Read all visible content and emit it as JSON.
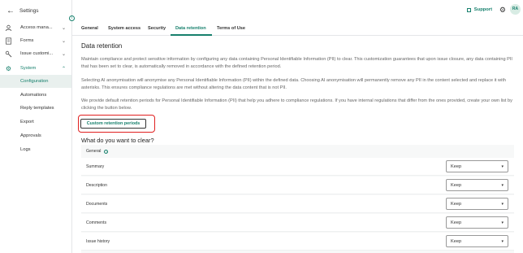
{
  "sidebar": {
    "header": {
      "back_icon": "arrow-left-icon",
      "title": "Settings"
    },
    "items": [
      {
        "label": "Access mana...",
        "icon": "user-icon"
      },
      {
        "label": "Forms",
        "icon": "form-icon"
      },
      {
        "label": "Issue customi...",
        "icon": "wrench-icon"
      },
      {
        "label": "System",
        "icon": "gear-icon"
      }
    ],
    "sub_items": [
      "Configuration",
      "Automations",
      "Reply templates",
      "Export",
      "Approvals",
      "Logs"
    ],
    "active_sub": "Configuration"
  },
  "topbar": {
    "support": "Support",
    "avatar_initials": "RA"
  },
  "tabs": [
    "General",
    "System access",
    "Security",
    "Data retention",
    "Terms of Use"
  ],
  "active_tab": "Data retention",
  "content": {
    "title": "Data retention",
    "para1": "Maintain compliance and protect sensitive information by configuring any data containing Personal Identifiable Information (PII) to clear. This customization guarantees that upon issue closure, any data containing PII that has been set to clear, is automatically removed in accordance with the defined retention period.",
    "para2": "Selecting AI anonymisation will anonymise any Personal Identifiable Information (PII) within the defined data. Choosing AI anonymisation will permanently remove any PII in the content selected and replace it with asterisks. This ensures compliance regulations are met without altering the data content that is not PII.",
    "para3": "We provide default retention periods for Personal Identifiable Information (PII) that help you adhere to compliance regulations. If you have internal regulations that differ from the ones provided, create your own list by clicking the button below.",
    "custom_button": "Custom retention periods",
    "subtitle": "What do you want to clear?",
    "group_label": "General",
    "rows": [
      {
        "label": "Summary",
        "value": "Keep"
      },
      {
        "label": "Description",
        "value": "Keep"
      },
      {
        "label": "Documents",
        "value": "Keep"
      },
      {
        "label": "Comments",
        "value": "Keep"
      },
      {
        "label": "Issue history",
        "value": "Keep"
      }
    ]
  },
  "colors": {
    "accent": "#17806d",
    "highlight": "#e02020"
  }
}
